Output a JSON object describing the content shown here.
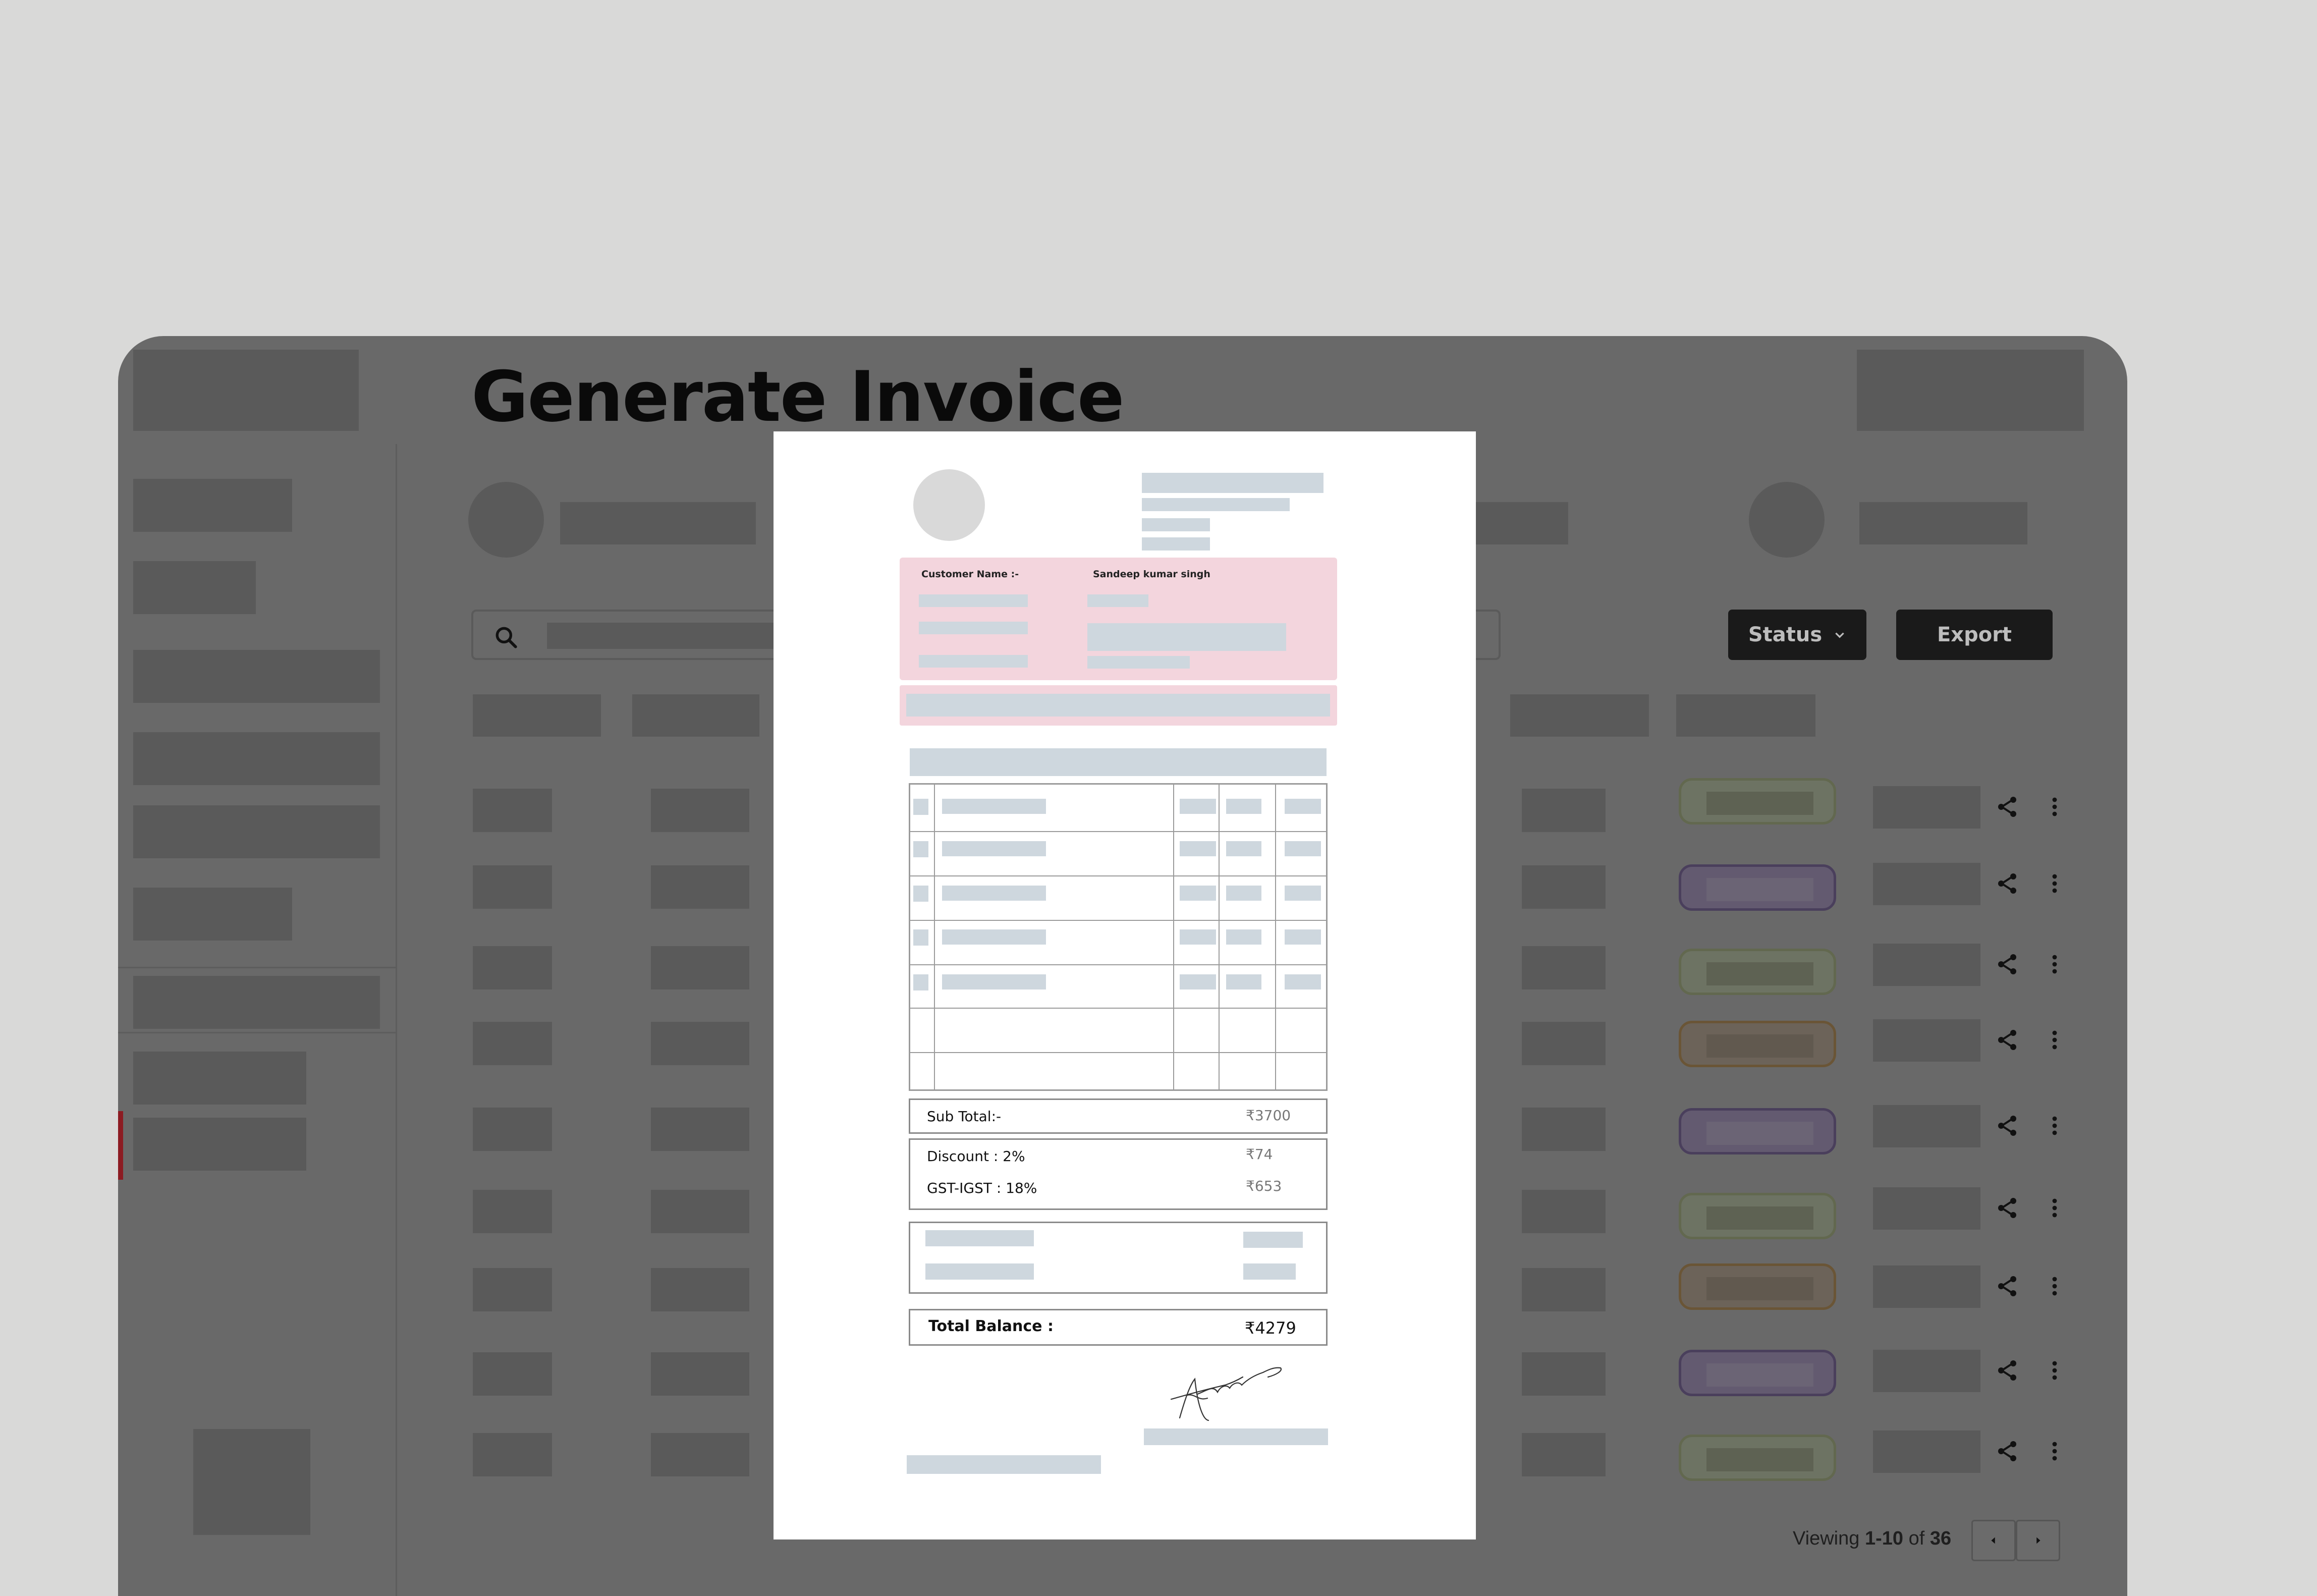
{
  "page": {
    "title": "Generate Invoice"
  },
  "toolbar": {
    "status_label": "Status",
    "export_label": "Export"
  },
  "icons": {
    "search": "search-icon",
    "chevron": "chevron-down-icon",
    "share": "share-icon",
    "more": "more-vertical-icon",
    "prev": "chevron-left-icon",
    "next": "chevron-right-icon"
  },
  "table": {
    "statuses": [
      "green",
      "purple",
      "green",
      "orange",
      "purple",
      "green",
      "orange",
      "purple",
      "green"
    ]
  },
  "pagination": {
    "prefix": "Viewing ",
    "range": "1-10",
    "of": " of ",
    "total": "36"
  },
  "invoice": {
    "customer_label": "Customer Name :-",
    "customer_value": "Sandeep kumar singh",
    "subtotal_label": "Sub Total:-",
    "subtotal_value": "₹3700",
    "discount_label": "Discount : 2%",
    "discount_value": "₹74",
    "gst_label": "GST-IGST : 18%",
    "gst_value": "₹653",
    "total_label": "Total Balance :",
    "total_value": "₹4279"
  },
  "colors": {
    "overlay_bg": "#696969",
    "invoice_pink": "#f3d5dd",
    "placeholder_gray": "#ced7de",
    "accent_red": "#b3121f"
  }
}
